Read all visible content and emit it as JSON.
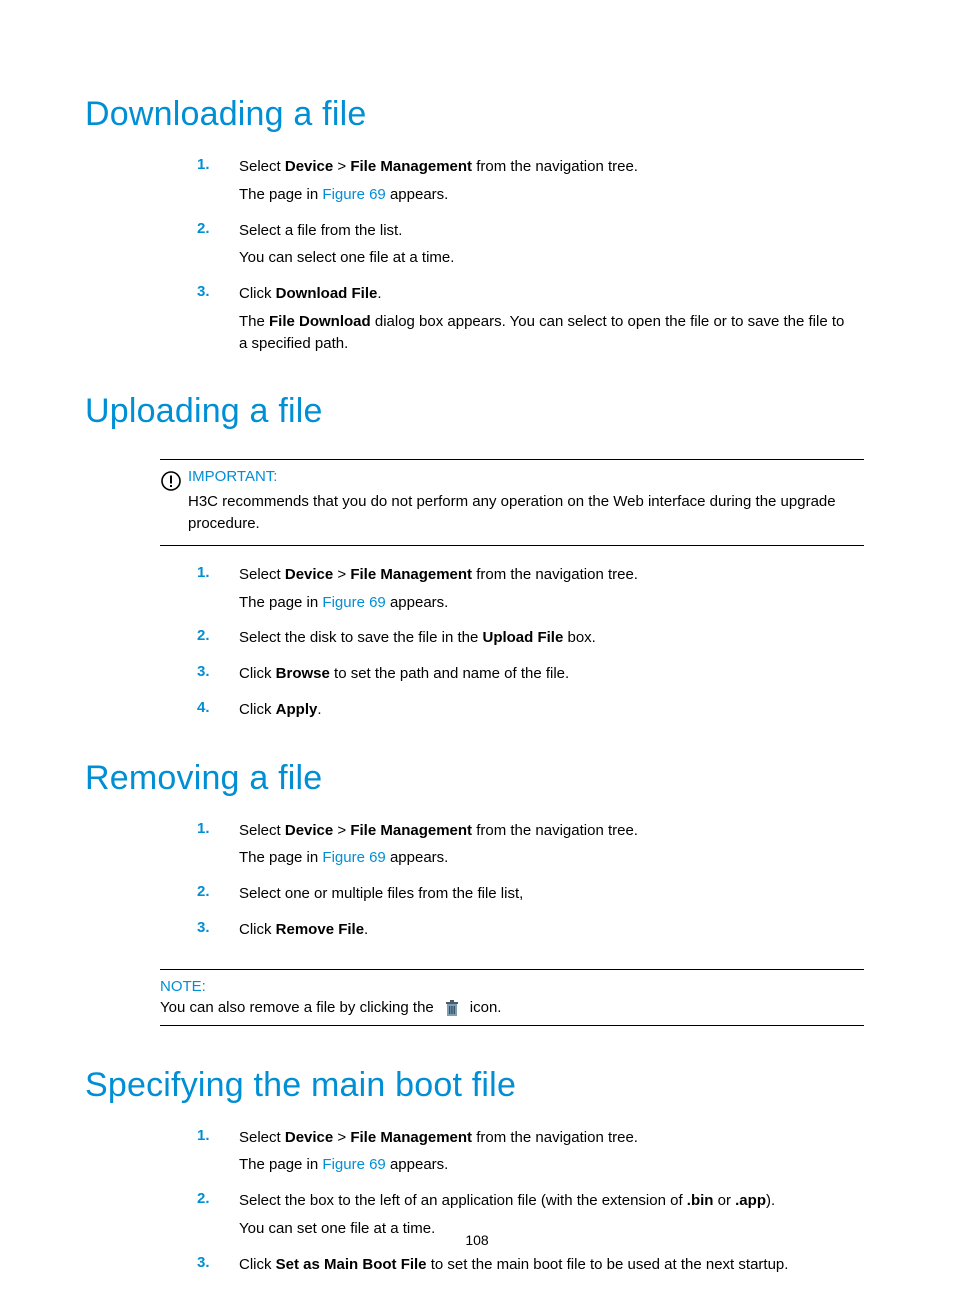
{
  "pageNumber": "108",
  "sections": {
    "download": {
      "title": "Downloading a file",
      "steps": [
        {
          "n": "1.",
          "lines": [
            [
              {
                "t": "Select "
              },
              {
                "t": "Device",
                "b": true
              },
              {
                "t": " > "
              },
              {
                "t": "File Management",
                "b": true
              },
              {
                "t": " from the navigation tree."
              }
            ],
            [
              {
                "t": "The page in "
              },
              {
                "t": "Figure 69",
                "link": true
              },
              {
                "t": " appears."
              }
            ]
          ]
        },
        {
          "n": "2.",
          "lines": [
            [
              {
                "t": "Select a file from the list."
              }
            ],
            [
              {
                "t": "You can select one file at a time."
              }
            ]
          ]
        },
        {
          "n": "3.",
          "lines": [
            [
              {
                "t": "Click "
              },
              {
                "t": "Download File",
                "b": true
              },
              {
                "t": "."
              }
            ],
            [
              {
                "t": "The "
              },
              {
                "t": "File Download",
                "b": true
              },
              {
                "t": " dialog box appears. You can select to open the file or to save the file to a specified path."
              }
            ]
          ]
        }
      ]
    },
    "upload": {
      "title": "Uploading a file",
      "importantLabel": "IMPORTANT:",
      "importantText": "H3C recommends that you do not perform any operation on the Web interface during the upgrade procedure.",
      "steps": [
        {
          "n": "1.",
          "lines": [
            [
              {
                "t": "Select "
              },
              {
                "t": "Device",
                "b": true
              },
              {
                "t": " > "
              },
              {
                "t": "File Management",
                "b": true
              },
              {
                "t": " from the navigation tree."
              }
            ],
            [
              {
                "t": "The page in "
              },
              {
                "t": "Figure 69",
                "link": true
              },
              {
                "t": " appears."
              }
            ]
          ]
        },
        {
          "n": "2.",
          "lines": [
            [
              {
                "t": "Select the disk to save the file in the "
              },
              {
                "t": "Upload File",
                "b": true
              },
              {
                "t": " box."
              }
            ]
          ]
        },
        {
          "n": "3.",
          "lines": [
            [
              {
                "t": "Click "
              },
              {
                "t": "Browse",
                "b": true
              },
              {
                "t": " to set the path and name of the file."
              }
            ]
          ]
        },
        {
          "n": "4.",
          "lines": [
            [
              {
                "t": "Click "
              },
              {
                "t": "Apply",
                "b": true
              },
              {
                "t": "."
              }
            ]
          ]
        }
      ]
    },
    "remove": {
      "title": "Removing a file",
      "steps": [
        {
          "n": "1.",
          "lines": [
            [
              {
                "t": "Select "
              },
              {
                "t": "Device",
                "b": true
              },
              {
                "t": " > "
              },
              {
                "t": "File Management",
                "b": true
              },
              {
                "t": " from the navigation tree."
              }
            ],
            [
              {
                "t": "The page in "
              },
              {
                "t": "Figure 69",
                "link": true
              },
              {
                "t": " appears."
              }
            ]
          ]
        },
        {
          "n": "2.",
          "lines": [
            [
              {
                "t": "Select one or multiple files from the file list,"
              }
            ]
          ]
        },
        {
          "n": "3.",
          "lines": [
            [
              {
                "t": "Click "
              },
              {
                "t": "Remove File",
                "b": true
              },
              {
                "t": "."
              }
            ]
          ]
        }
      ],
      "noteLabel": "NOTE:",
      "noteBefore": "You can also remove a file by clicking the",
      "noteAfter": "icon."
    },
    "boot": {
      "title": "Specifying the main boot file",
      "steps": [
        {
          "n": "1.",
          "lines": [
            [
              {
                "t": "Select "
              },
              {
                "t": "Device",
                "b": true
              },
              {
                "t": " > "
              },
              {
                "t": "File Management",
                "b": true
              },
              {
                "t": " from the navigation tree."
              }
            ],
            [
              {
                "t": "The page in "
              },
              {
                "t": "Figure 69",
                "link": true
              },
              {
                "t": " appears."
              }
            ]
          ]
        },
        {
          "n": "2.",
          "lines": [
            [
              {
                "t": "Select the box to the left of an application file (with the extension of "
              },
              {
                "t": ".bin",
                "b": true
              },
              {
                "t": " or "
              },
              {
                "t": ".app",
                "b": true
              },
              {
                "t": ")."
              }
            ],
            [
              {
                "t": "You can set one file at a time."
              }
            ]
          ]
        },
        {
          "n": "3.",
          "lines": [
            [
              {
                "t": "Click "
              },
              {
                "t": "Set as Main Boot File",
                "b": true
              },
              {
                "t": " to set the main boot file to be used at the next startup."
              }
            ]
          ]
        }
      ]
    }
  }
}
